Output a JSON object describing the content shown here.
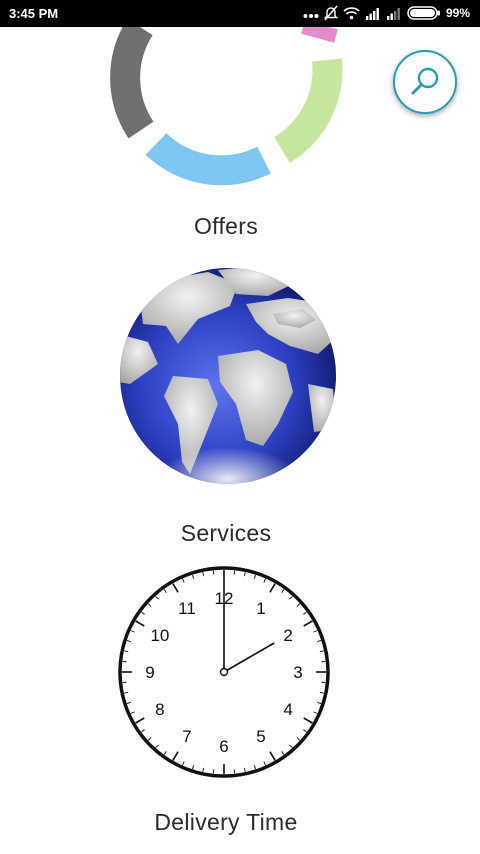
{
  "status_bar": {
    "time": "3:45 PM",
    "battery": "99%",
    "icons": [
      "more-dots-icon",
      "mute-icon",
      "wifi-icon",
      "signal-icon",
      "signal-icon-2",
      "battery-icon"
    ]
  },
  "menu": {
    "items": [
      {
        "label": "Offers",
        "icon": "ring-segments-icon"
      },
      {
        "label": "Services",
        "icon": "globe-icon"
      },
      {
        "label": "Delivery Time",
        "icon": "clock-icon"
      }
    ]
  },
  "search": {
    "icon": "search-icon",
    "color": "#2a9bb5"
  },
  "clock": {
    "numerals": [
      "12",
      "1",
      "2",
      "3",
      "4",
      "5",
      "6",
      "7",
      "8",
      "9",
      "10",
      "11"
    ],
    "hour": 2,
    "minute": 0
  },
  "colors": {
    "ring_gray": "#6f6f6f",
    "ring_blue": "#7ec7f2",
    "ring_green": "#c6e6a0",
    "ring_pink": "#e58ccc",
    "globe_blue": "#1b2a8e"
  }
}
